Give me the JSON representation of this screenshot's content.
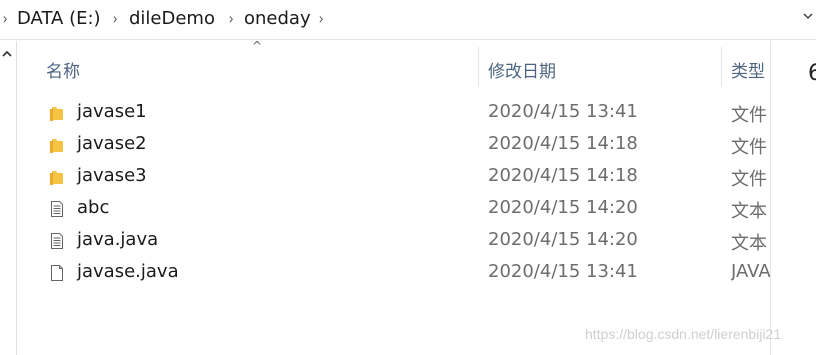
{
  "breadcrumb": {
    "items": [
      {
        "label": "DATA (E:)"
      },
      {
        "label": "dileDemo"
      },
      {
        "label": "oneday"
      }
    ],
    "separator": "›",
    "dropdown": "⌄"
  },
  "columns": {
    "name": "名称",
    "date": "修改日期",
    "type": "类型",
    "sort_indicator": "^"
  },
  "files": [
    {
      "name": "javase1",
      "date": "2020/4/15 13:41",
      "type": "文件",
      "icon": "folder-icon"
    },
    {
      "name": "javase2",
      "date": "2020/4/15 14:18",
      "type": "文件",
      "icon": "folder-icon"
    },
    {
      "name": "javase3",
      "date": "2020/4/15 14:18",
      "type": "文件",
      "icon": "folder-icon"
    },
    {
      "name": "abc",
      "date": "2020/4/15 14:20",
      "type": "文本",
      "icon": "text-file-icon"
    },
    {
      "name": "java.java",
      "date": "2020/4/15 14:20",
      "type": "文本",
      "icon": "text-file-icon"
    },
    {
      "name": "javase.java",
      "date": "2020/4/15 13:41",
      "type": "JAVA",
      "icon": "blank-file-icon"
    }
  ],
  "right_panel_char": "6",
  "watermark": "https://blog.csdn.net/lierenbiji21",
  "colors": {
    "header_text": "#4d6582",
    "folder": "#f6c343",
    "date_text": "#6d6d6d"
  }
}
